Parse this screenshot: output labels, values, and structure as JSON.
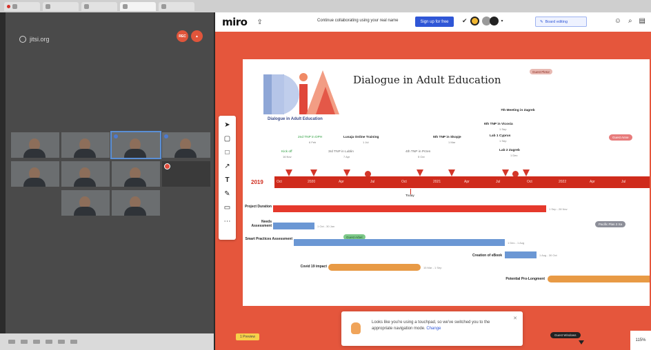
{
  "app": {
    "logo": "miro"
  },
  "jitsi": {
    "logo_text": "jitsi.org",
    "rec_label": "REC"
  },
  "miro_top": {
    "collab_text": "Continue collaborating using your real name",
    "signup_label": "Sign up for free",
    "edit_label": "Board editing",
    "zoom": "115%"
  },
  "board": {
    "title": "Dialogue in Adult Education",
    "logo_caption": "Dialogue in Adult Education",
    "start_year": "2019",
    "months": [
      "Oct",
      "2020",
      "Apr",
      "Jul",
      "Oct",
      "2021",
      "Apr",
      "Jul",
      "Oct",
      "2022",
      "Apr",
      "Jul"
    ],
    "today": "Today",
    "events": [
      {
        "label": "Kick off",
        "sub": "16 Nov",
        "style": "green"
      },
      {
        "label": "2nd TNP in DPH",
        "sub": "6 Feb",
        "style": "green"
      },
      {
        "label": "3rd TNP in Lublin",
        "sub": "7 Apr",
        "style": "grey"
      },
      {
        "label": "Lusaja Online Training",
        "sub": "1 Jul",
        "style": "bold"
      },
      {
        "label": "4th TNP in Przen",
        "sub": "5 Oct",
        "style": "grey"
      },
      {
        "label": "5th TNP in Skopje",
        "sub": "1 Mar",
        "style": "bold"
      },
      {
        "label": "Lab 1 Cyprus",
        "sub": "1 Sep",
        "style": "bold"
      },
      {
        "label": "6th TNP in Vicosia",
        "sub": "1 Sep",
        "style": "bold"
      },
      {
        "label": "7th Meeting in Zagreb",
        "sub": "1 Dec",
        "style": "bold"
      },
      {
        "label": "Lab 2 Zagreb",
        "sub": "1 Dec",
        "style": "bold"
      }
    ],
    "rows": [
      {
        "label": "Project Duration",
        "dates": "1 Sep - 28 Nov",
        "color": "#e5392c"
      },
      {
        "label": "Needs Assessment",
        "dates": "1 Oct - 30 Jan",
        "color": "#6b97d4"
      },
      {
        "label": "Smart Practices Assessment",
        "dates": "1 Dec - 1 Aug",
        "color": "#6b97d4"
      },
      {
        "label": "Creation of eBook",
        "dates": "1 Aug - 30 Oct",
        "color": "#6b97d4"
      },
      {
        "label": "Covid 19 impact",
        "dates": "15 Mar - 1 Sep",
        "color": "#e89a45"
      },
      {
        "label": "Potential Pro-Longment",
        "dates": "",
        "color": "#e89a45"
      }
    ],
    "guest_pills": [
      "Guest Pletor",
      "Guest Arbel"
    ],
    "right_pills": [
      "Guest Anne",
      "Pacific Plan 3 Xa"
    ]
  },
  "toast": {
    "text": "Looks like you're using a touchpad, so we've switched you to the appropriate navigation mode.",
    "link": "Change"
  },
  "bottom": {
    "pill": "1 Preview",
    "minimap": "Guest Windows"
  },
  "colors": {
    "miro_bg": "#e5563c",
    "timeline": "#cf2b1c",
    "signup": "#2f56d6"
  }
}
